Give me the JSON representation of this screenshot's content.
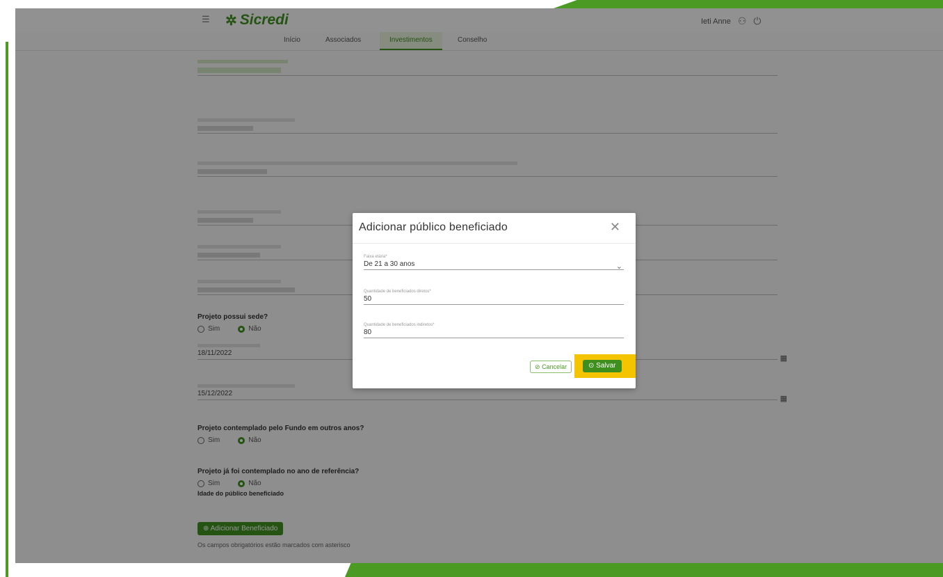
{
  "header": {
    "logo_text": "Sicredi",
    "user_name": "Ieti Anne",
    "brand_color": "#3f8f1f"
  },
  "tabs": [
    {
      "label": "Início"
    },
    {
      "label": "Associados"
    },
    {
      "label": "Investimentos"
    },
    {
      "label": "Conselho"
    }
  ],
  "form": {
    "q_sede": "Projeto possui sede?",
    "q_sede_yes": "Sim",
    "q_sede_no": "Não",
    "q_patrocinio": "Projeto contemplado pelo Fundo em outros anos?",
    "q_patrocinio_yes": "Sim",
    "q_patrocinio_no": "Não",
    "q_contemplado": "Projeto já foi contemplado no ano de referência?",
    "q_contemplado_yes": "Sim",
    "q_contemplado_no": "Não",
    "publico_title": "Idade do público beneficiado",
    "add_button": "Adicionar Beneficiado",
    "footer_note": "Os campos obrigatórios estão marcados com asterisco",
    "date_start": "18/11/2022",
    "date_end": "15/12/2022"
  },
  "modal": {
    "title": "Adicionar público beneficiado",
    "faixa_label": "Faixa etária*",
    "faixa_value": "De 21 a 30 anos",
    "qtd_direta_label": "Quantidade de beneficiados diretos*",
    "qtd_direta_value": "50",
    "qtd_indireta_label": "Quantidade de beneficiados indiretos*",
    "qtd_indireta_value": "80",
    "cancel_label": "Cancelar",
    "save_label": "Salvar",
    "highlight_color": "#f5c400"
  }
}
